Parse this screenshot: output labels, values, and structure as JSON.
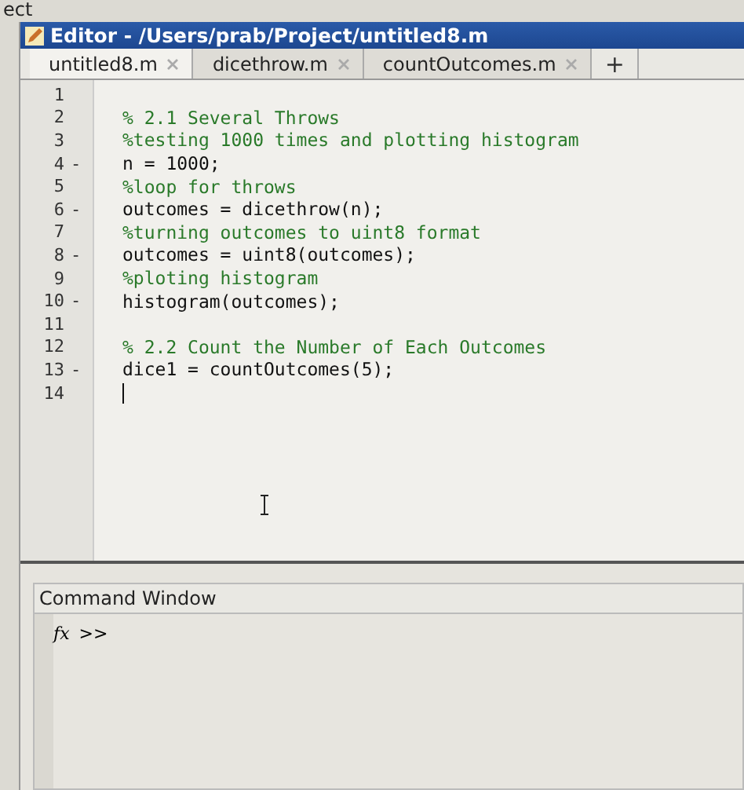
{
  "background_label": "ect",
  "window": {
    "title": "Editor - /Users/prab/Project/untitled8.m"
  },
  "tabs": [
    {
      "label": "untitled8.m",
      "selected": true
    },
    {
      "label": "dicethrow.m",
      "selected": false
    },
    {
      "label": "countOutcomes.m",
      "selected": false
    }
  ],
  "new_tab": "+",
  "lines": [
    {
      "number": "1",
      "kind": "blank",
      "caret": false
    },
    {
      "number": "2",
      "kind": "comment",
      "text": "% 2.1 Several Throws",
      "caret": false
    },
    {
      "number": "3",
      "kind": "comment",
      "text": "%testing 1000 times and plotting histogram",
      "caret": false
    },
    {
      "number": "4",
      "marker": "-",
      "kind": "code",
      "text": "n = 1000;",
      "caret": false
    },
    {
      "number": "5",
      "kind": "comment",
      "text": "%loop for throws",
      "caret": false
    },
    {
      "number": "6",
      "marker": "-",
      "kind": "code",
      "text": "outcomes = dicethrow(n);",
      "caret": false
    },
    {
      "number": "7",
      "kind": "comment",
      "text": "%turning outcomes to uint8 format",
      "caret": false
    },
    {
      "number": "8",
      "marker": "-",
      "kind": "code",
      "text": "outcomes = uint8(outcomes);",
      "caret": false
    },
    {
      "number": "9",
      "kind": "comment",
      "text": "%ploting histogram",
      "caret": false
    },
    {
      "number": "10",
      "marker": "-",
      "kind": "code",
      "text": "histogram(outcomes);",
      "caret": false
    },
    {
      "number": "11",
      "kind": "blank",
      "caret": false
    },
    {
      "number": "12",
      "kind": "comment",
      "text": "% 2.2 Count the Number of Each Outcomes",
      "caret": false
    },
    {
      "number": "13",
      "marker": "-",
      "kind": "code",
      "text": "dice1 = countOutcomes(5);",
      "caret": false
    },
    {
      "number": "14",
      "kind": "blank",
      "caret": true
    }
  ],
  "command_window": {
    "title": "Command Window",
    "function_button": "fx",
    "prompt": ">>"
  }
}
